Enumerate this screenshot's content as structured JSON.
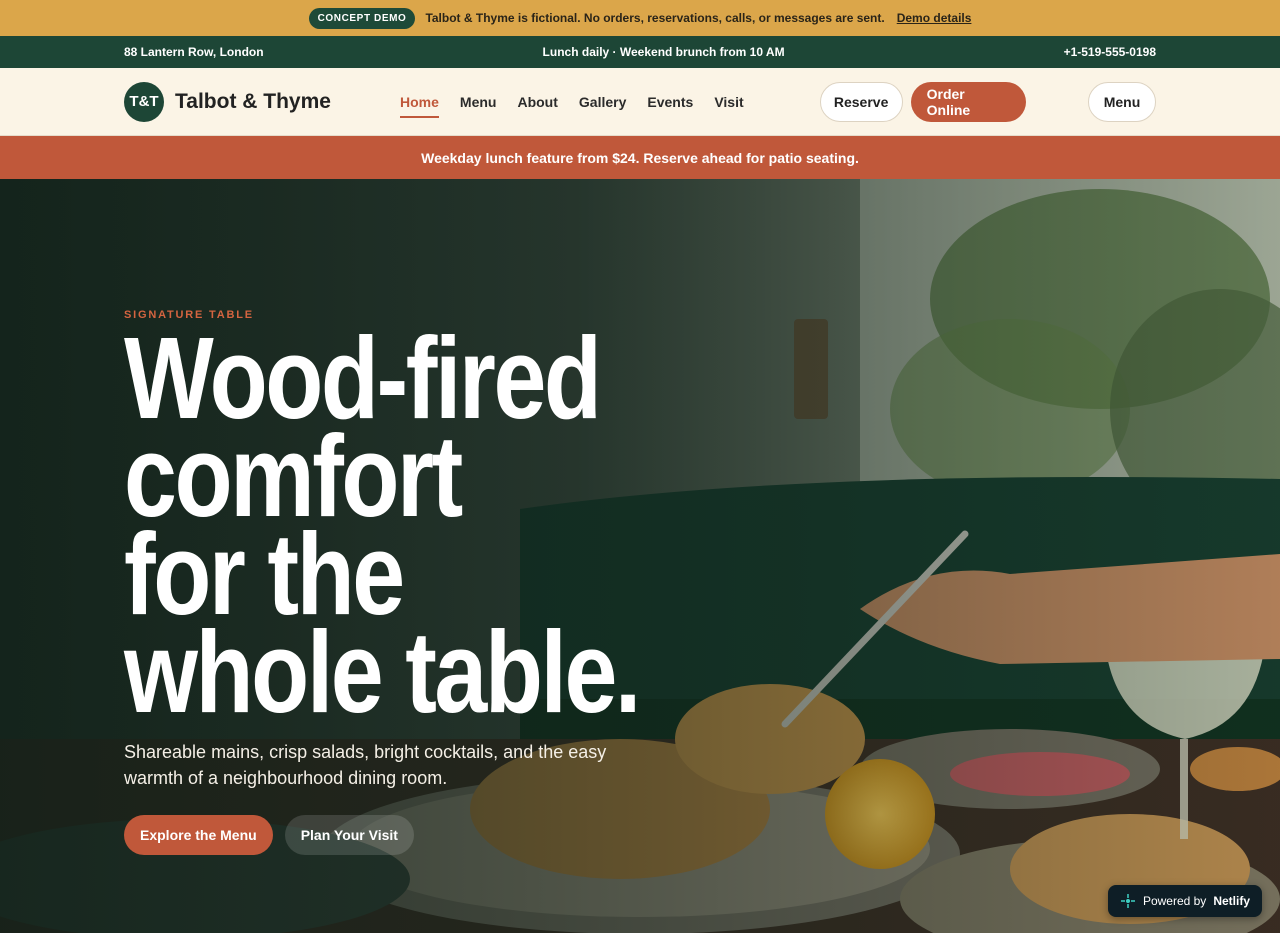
{
  "demo_bar": {
    "pill": "CONCEPT DEMO",
    "message": "Talbot & Thyme is fictional. No orders, reservations, calls, or messages are sent.",
    "link": "Demo details"
  },
  "info_bar": {
    "address": "88 Lantern Row, London",
    "hours": "Lunch daily · Weekend brunch from 10 AM",
    "phone": "+1-519-555-0198"
  },
  "header": {
    "logo_text": "T&T",
    "brand_name": "Talbot & Thyme",
    "nav": [
      {
        "label": "Home",
        "active": true
      },
      {
        "label": "Menu"
      },
      {
        "label": "About"
      },
      {
        "label": "Gallery"
      },
      {
        "label": "Events"
      },
      {
        "label": "Visit"
      }
    ],
    "reserve_label": "Reserve",
    "order_label": "Order Online",
    "menu_label": "Menu"
  },
  "promo": {
    "text": "Weekday lunch feature from $24. Reserve ahead for patio seating."
  },
  "hero": {
    "eyebrow": "SIGNATURE TABLE",
    "headline": [
      "Wood-fired",
      "comfort",
      "for the",
      "whole table."
    ],
    "subtext": "Shareable mains, crisp salads, bright cocktails, and the easy warmth of a neighbourhood dining room.",
    "primary_cta": "Explore the Menu",
    "secondary_cta": "Plan Your Visit"
  },
  "badge": {
    "prefix": "Powered by",
    "brand": "Netlify"
  },
  "colors": {
    "accent": "#c0583a",
    "forest": "#1d4636",
    "banner": "#dba64a",
    "cream": "#fbf4e6"
  }
}
